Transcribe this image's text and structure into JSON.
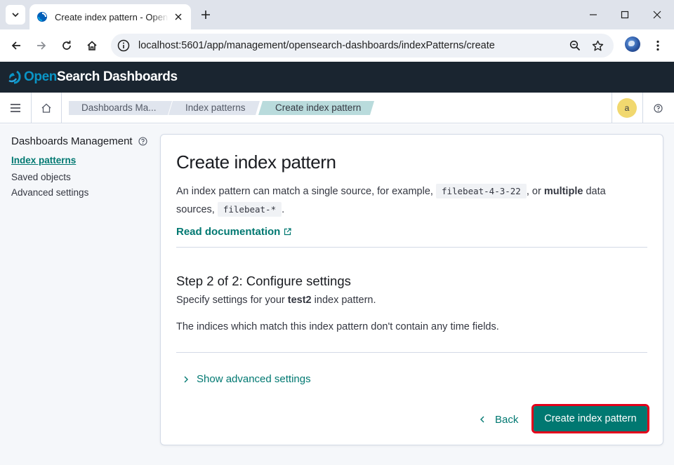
{
  "browser": {
    "tab_title": "Create index pattern - OpenSearch Dashboards",
    "url": "localhost:5601/app/management/opensearch-dashboards/indexPatterns/create"
  },
  "app": {
    "logo_part1": "Open",
    "logo_part2": "Search Dashboards"
  },
  "breadcrumbs": [
    {
      "label": "Dashboards Ma..."
    },
    {
      "label": "Index patterns"
    },
    {
      "label": "Create index pattern"
    }
  ],
  "user": {
    "avatar_initial": "a"
  },
  "sidebar": {
    "title": "Dashboards Management",
    "items": [
      {
        "label": "Index patterns"
      },
      {
        "label": "Saved objects"
      },
      {
        "label": "Advanced settings"
      }
    ]
  },
  "panel": {
    "title": "Create index pattern",
    "desc_1": "An index pattern can match a single source, for example, ",
    "code_1": "filebeat-4-3-22",
    "desc_2": ", or ",
    "desc_bold": "multiple",
    "desc_3": " data sources, ",
    "code_2": "filebeat-*",
    "desc_4": ".",
    "doc_link": "Read documentation",
    "step_title": "Step 2 of 2: Configure settings",
    "specify_pre": "Specify settings for your ",
    "specify_name": "test2",
    "specify_post": " index pattern.",
    "no_time_fields": "The indices which match this index pattern don't contain any time fields.",
    "advanced_toggle": "Show advanced settings",
    "back_label": "Back",
    "create_label": "Create index pattern"
  },
  "colors": {
    "accent": "#007871",
    "header_bg": "#1a2530",
    "highlight_outline": "#e3001b"
  }
}
